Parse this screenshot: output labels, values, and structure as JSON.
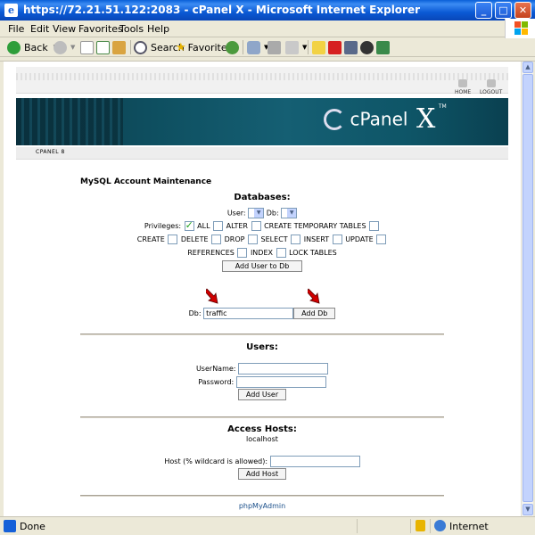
{
  "window": {
    "title": "https://72.21.51.122:2083 - cPanel X - Microsoft Internet Explorer",
    "app_icon": "ie-icon",
    "controls": [
      "minimize-icon",
      "maximize-icon",
      "close-icon"
    ]
  },
  "menu": {
    "items": [
      "File",
      "Edit",
      "View",
      "Favorites",
      "Tools",
      "Help"
    ]
  },
  "toolbar": {
    "back": "Back",
    "search": "Search",
    "favorites": "Favorites"
  },
  "cpanel": {
    "nav": {
      "home": "HOME",
      "logout": "LOGOUT"
    },
    "logo_text": "cPanel",
    "logo_x": "X",
    "logo_tm": "TM",
    "crumb": "CPANEL 8"
  },
  "mysql": {
    "title": "MySQL Account Maintenance",
    "databases_heading": "Databases:",
    "user_label": "User:",
    "db_label": "Db:",
    "privileges_label": "Privileges:",
    "privileges": {
      "all": "ALL",
      "alter": "ALTER",
      "create_temp": "CREATE TEMPORARY TABLES",
      "create": "CREATE",
      "delete": "DELETE",
      "drop": "DROP",
      "select": "SELECT",
      "insert": "INSERT",
      "update": "UPDATE",
      "references": "REFERENCES",
      "index": "INDEX",
      "lock": "LOCK TABLES"
    },
    "add_user_to_db": "Add User to Db",
    "new_db_label": "Db:",
    "new_db_value": "traffic",
    "add_db": "Add Db",
    "users_heading": "Users:",
    "username_label": "UserName:",
    "password_label": "Password:",
    "add_user": "Add User",
    "access_hosts_heading": "Access Hosts:",
    "access_host_entry": "localhost",
    "host_label": "Host (% wildcard is allowed):",
    "add_host": "Add Host",
    "phpmyadmin": "phpMyAdmin"
  },
  "status": {
    "text": "Done",
    "zone": "Internet"
  },
  "colors": {
    "titlebar": "#0A5FD8",
    "banner": "#0E4F60",
    "arrow": "#D00000",
    "link": "#1A4F8A"
  }
}
